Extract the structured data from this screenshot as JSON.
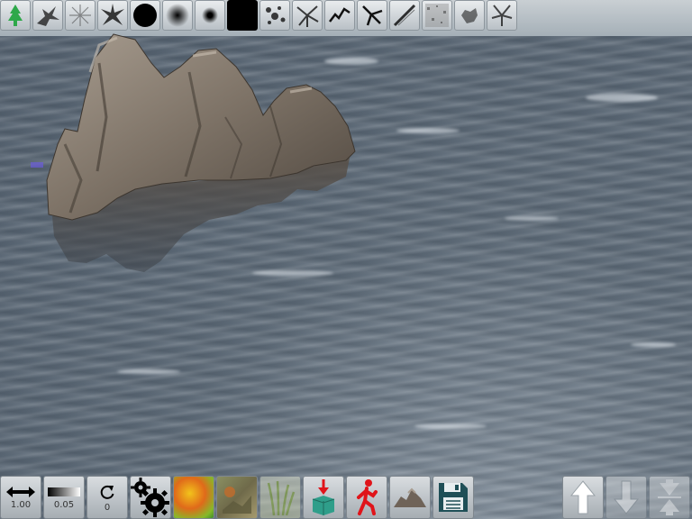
{
  "brushes": [
    {
      "name": "tree-brush-icon",
      "active": true
    },
    {
      "name": "splat-brush-icon"
    },
    {
      "name": "frost-brush-icon"
    },
    {
      "name": "star-brush-icon"
    },
    {
      "name": "hard-round-brush-icon"
    },
    {
      "name": "soft-round-brush-icon"
    },
    {
      "name": "small-round-brush-icon"
    },
    {
      "name": "black-square-brush-icon"
    },
    {
      "name": "scatter-brush-icon"
    },
    {
      "name": "burst-brush-icon"
    },
    {
      "name": "crack-brush-icon"
    },
    {
      "name": "vein-brush-icon"
    },
    {
      "name": "streak-brush-icon"
    },
    {
      "name": "noise-brush-icon"
    },
    {
      "name": "rough-brush-icon"
    },
    {
      "name": "spike-brush-icon"
    }
  ],
  "toolbar": {
    "size": {
      "icon": "horizontal-arrows-icon",
      "value": "1.00"
    },
    "strength": {
      "icon": "gradient-icon",
      "value": "0.05"
    },
    "rotation": {
      "icon": "rotate-icon",
      "value": "0"
    },
    "settings": {
      "icon": "gears-icon"
    },
    "paint": {
      "icon": "heightmap-texture-icon"
    },
    "ground": {
      "icon": "ground-texture-icon"
    },
    "grass": {
      "icon": "grass-icon"
    },
    "object": {
      "icon": "place-object-icon"
    },
    "walk": {
      "icon": "walk-mode-icon"
    },
    "terrain": {
      "icon": "terrain-icon"
    },
    "save": {
      "icon": "floppy-disk-icon"
    },
    "raise": {
      "icon": "arrow-up-icon"
    },
    "lower": {
      "icon": "arrow-down-icon"
    },
    "flatten": {
      "icon": "flatten-icon"
    }
  },
  "colors": {
    "water": "#5f6c79",
    "rock": "#8a7f72",
    "active_brush": "#2ea84a",
    "walk_figure": "#e0141a",
    "save_icon": "#1f4f57"
  }
}
